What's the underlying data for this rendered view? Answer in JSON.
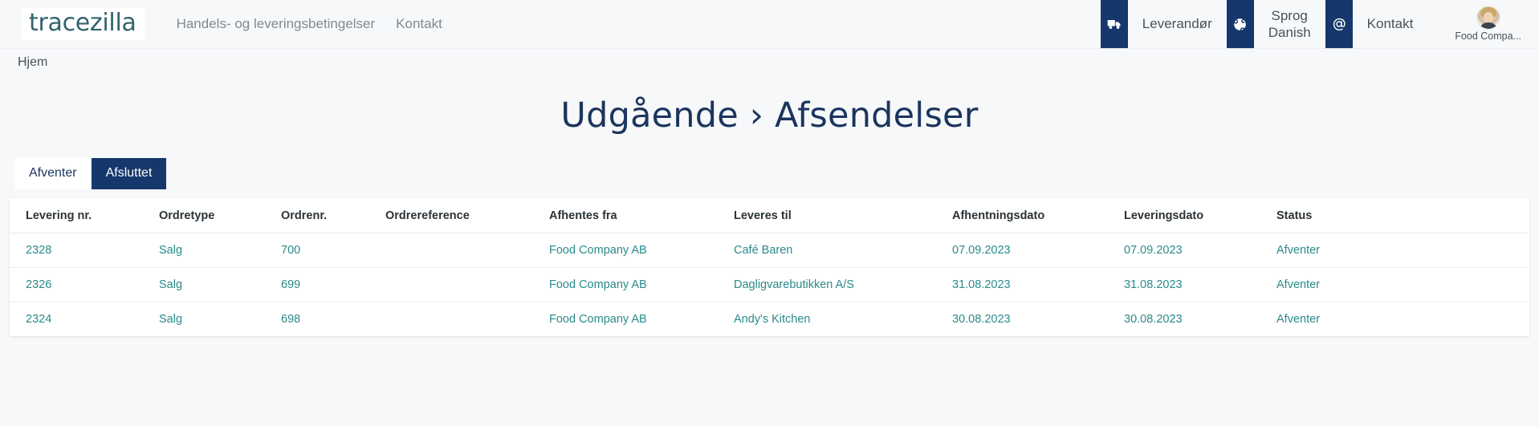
{
  "brand": {
    "logo_text": "tracezilla",
    "logo_color": "#33636e"
  },
  "topnav": {
    "links": [
      {
        "label": "Handels- og leveringsbetingelser"
      },
      {
        "label": "Kontakt"
      }
    ],
    "right": {
      "truck_item": {
        "icon": "truck-icon",
        "label": "Leverandør"
      },
      "language_item": {
        "icon": "globe-icon",
        "label": "Sprog",
        "value": "Danish"
      },
      "contact_item": {
        "icon": "at-sign-icon",
        "label": "Kontakt"
      },
      "user": {
        "avatar": "user-avatar",
        "name": "Food Compa..."
      }
    },
    "accent_color": "#16376b"
  },
  "breadcrumb": {
    "items": [
      {
        "label": "Hjem"
      }
    ]
  },
  "page": {
    "title": "Udgående › Afsendelser",
    "title_color": "#1c355e"
  },
  "tabs": [
    {
      "label": "Afventer",
      "active": false
    },
    {
      "label": "Afsluttet",
      "active": true
    }
  ],
  "table": {
    "columns": [
      "Levering nr.",
      "Ordretype",
      "Ordrenr.",
      "Ordrereference",
      "Afhentes fra",
      "Leveres til",
      "Afhentningsdato",
      "Leveringsdato",
      "Status"
    ],
    "rows": [
      {
        "levering_nr": "2328",
        "ordretype": "Salg",
        "ordrenr": "700",
        "ordrereference": "",
        "afhentes_fra": "Food Company AB",
        "leveres_til": "Café Baren",
        "afhentningsdato": "07.09.2023",
        "leveringsdato": "07.09.2023",
        "status": "Afventer"
      },
      {
        "levering_nr": "2326",
        "ordretype": "Salg",
        "ordrenr": "699",
        "ordrereference": "",
        "afhentes_fra": "Food Company AB",
        "leveres_til": "Dagligvarebutikken A/S",
        "afhentningsdato": "31.08.2023",
        "leveringsdato": "31.08.2023",
        "status": "Afventer"
      },
      {
        "levering_nr": "2324",
        "ordretype": "Salg",
        "ordrenr": "698",
        "ordrereference": "",
        "afhentes_fra": "Food Company AB",
        "leveres_til": "Andy's Kitchen",
        "afhentningsdato": "30.08.2023",
        "leveringsdato": "30.08.2023",
        "status": "Afventer"
      }
    ],
    "link_color": "#2a8a8a"
  }
}
